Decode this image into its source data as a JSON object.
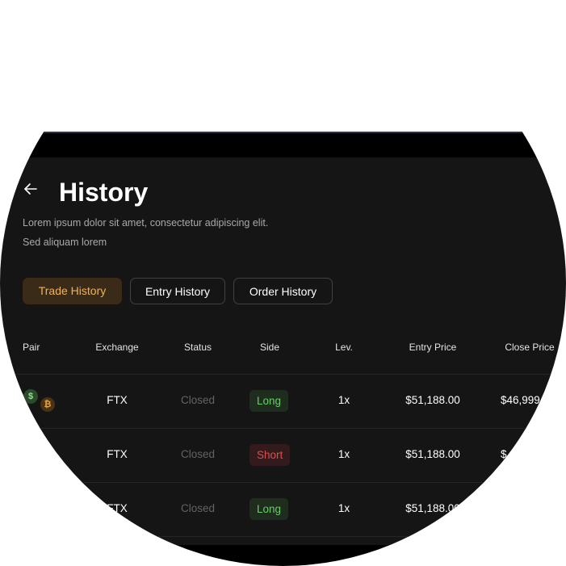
{
  "header": {
    "back_icon": "arrow-left-icon",
    "title": "History",
    "description": "Lorem ipsum dolor sit amet, consectetur adipiscing elit. Sed aliquam lorem"
  },
  "tabs": [
    {
      "label": "Trade History",
      "active": true
    },
    {
      "label": "Entry History",
      "active": false
    },
    {
      "label": "Order History",
      "active": false
    }
  ],
  "table": {
    "columns": [
      "Pair",
      "Exchange",
      "Status",
      "Side",
      "Lev.",
      "Entry Price",
      "Close Price"
    ],
    "rows": [
      {
        "exchange": "FTX",
        "status": "Closed",
        "side": "Long",
        "lev": "1x",
        "entry": "$51,188.00",
        "close": "$46,999"
      },
      {
        "exchange": "FTX",
        "status": "Closed",
        "side": "Short",
        "lev": "1x",
        "entry": "$51,188.00",
        "close": "$"
      },
      {
        "exchange": "FTX",
        "status": "Closed",
        "side": "Long",
        "lev": "1x",
        "entry": "$51,188.00",
        "close": ""
      }
    ]
  },
  "pair_icons": [
    "dollar-coin-icon",
    "bitcoin-coin-icon"
  ],
  "pair_icon_glyphs": [
    "$",
    "₿"
  ],
  "colors": {
    "background": "#151515",
    "accent": "#f0b357",
    "long": "#6ccc6c",
    "short": "#e14b4b"
  }
}
